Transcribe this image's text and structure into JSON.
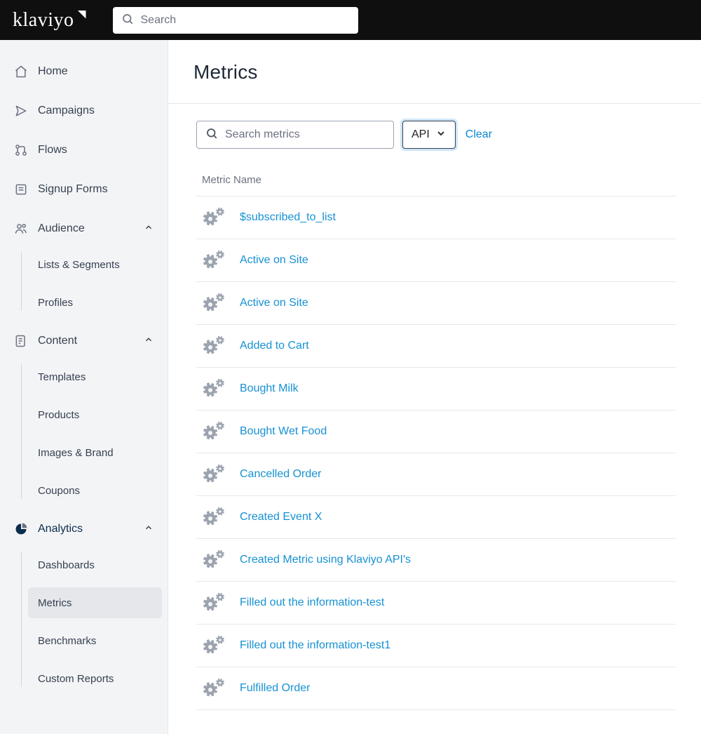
{
  "header": {
    "logo_text": "klaviyo",
    "search_placeholder": "Search"
  },
  "sidebar": {
    "items": [
      {
        "key": "home",
        "label": "Home",
        "expandable": false
      },
      {
        "key": "campaigns",
        "label": "Campaigns",
        "expandable": false
      },
      {
        "key": "flows",
        "label": "Flows",
        "expandable": false
      },
      {
        "key": "signup",
        "label": "Signup Forms",
        "expandable": false
      },
      {
        "key": "audience",
        "label": "Audience",
        "expandable": true,
        "children": [
          "Lists & Segments",
          "Profiles"
        ]
      },
      {
        "key": "content",
        "label": "Content",
        "expandable": true,
        "children": [
          "Templates",
          "Products",
          "Images & Brand",
          "Coupons"
        ]
      },
      {
        "key": "analytics",
        "label": "Analytics",
        "expandable": true,
        "active": true,
        "children": [
          "Dashboards",
          "Metrics",
          "Benchmarks",
          "Custom Reports"
        ],
        "selected_child": "Metrics"
      }
    ]
  },
  "page": {
    "title": "Metrics",
    "search_placeholder": "Search metrics",
    "filter_label": "API",
    "clear_label": "Clear",
    "column_header": "Metric Name",
    "metrics": [
      "$subscribed_to_list",
      "Active on Site",
      "Active on Site",
      "Added to Cart",
      "Bought Milk",
      "Bought Wet Food",
      "Cancelled Order",
      "Created Event X",
      "Created Metric using Klaviyo API's",
      "Filled out the information-test",
      "Filled out the information-test1",
      "Fulfilled Order"
    ]
  }
}
